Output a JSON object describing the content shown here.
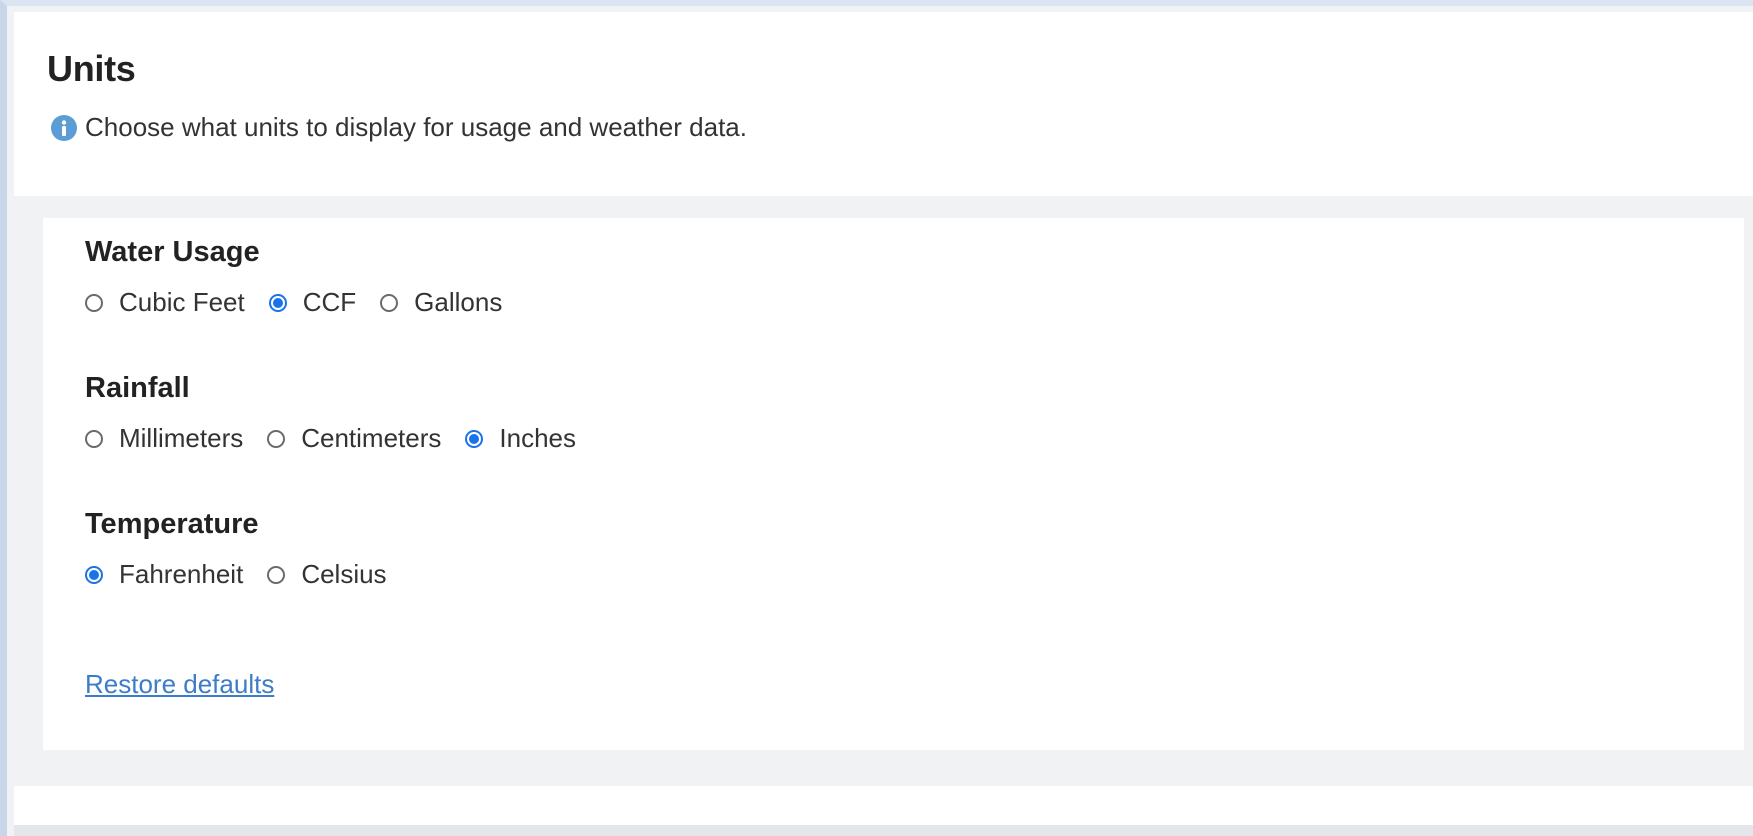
{
  "header": {
    "title": "Units",
    "info_icon": "info-icon",
    "description": "Choose what units to display for usage and weather data."
  },
  "colors": {
    "accent": "#1a73e8",
    "link": "#3d7cc9",
    "info": "#5b9ed6"
  },
  "groups": [
    {
      "title": "Water Usage",
      "options": [
        {
          "label": "Cubic Feet",
          "checked": false
        },
        {
          "label": "CCF",
          "checked": true
        },
        {
          "label": "Gallons",
          "checked": false
        }
      ]
    },
    {
      "title": "Rainfall",
      "options": [
        {
          "label": "Millimeters",
          "checked": false
        },
        {
          "label": "Centimeters",
          "checked": false
        },
        {
          "label": "Inches",
          "checked": true
        }
      ]
    },
    {
      "title": "Temperature",
      "options": [
        {
          "label": "Fahrenheit",
          "checked": true
        },
        {
          "label": "Celsius",
          "checked": false
        }
      ]
    }
  ],
  "restore_link": "Restore defaults"
}
